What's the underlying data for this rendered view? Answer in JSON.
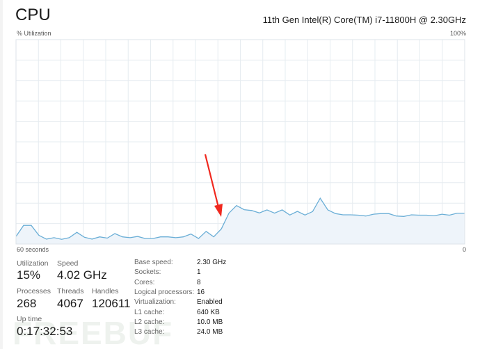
{
  "header": {
    "title": "CPU",
    "model": "11th Gen Intel(R) Core(TM) i7-11800H @ 2.30GHz"
  },
  "graph": {
    "y_label": "% Utilization",
    "y_max_label": "100%",
    "x_left_label": "60 seconds",
    "x_right_label": "0",
    "line_color": "#6aaed6",
    "fill_color": "#eef4fa",
    "grid_color": "#e6ecf0",
    "values": [
      3.7,
      9.1,
      9.1,
      4.3,
      2.4,
      3.1,
      2.3,
      3.1,
      5.7,
      3.3,
      2.4,
      3.5,
      2.9,
      5.1,
      3.5,
      3.1,
      3.7,
      2.7,
      2.7,
      3.5,
      3.5,
      3.1,
      3.5,
      4.9,
      2.7,
      6.2,
      3.5,
      7.4,
      15.1,
      18.8,
      16.8,
      16.4,
      15.2,
      16.7,
      15.1,
      16.7,
      14.2,
      16.0,
      14.2,
      15.9,
      22.4,
      16.7,
      14.9,
      14.3,
      14.3,
      14.1,
      13.7,
      14.6,
      14.9,
      14.9,
      13.7,
      13.5,
      14.3,
      14.1,
      14.1,
      13.8,
      14.6,
      14.1,
      15.1,
      15.1
    ]
  },
  "annotation": {
    "arrow_color": "#f0281e"
  },
  "stats": {
    "utilization": {
      "label": "Utilization",
      "value": "15%"
    },
    "speed": {
      "label": "Speed",
      "value": "4.02 GHz"
    },
    "processes": {
      "label": "Processes",
      "value": "268"
    },
    "threads": {
      "label": "Threads",
      "value": "4067"
    },
    "handles": {
      "label": "Handles",
      "value": "120611"
    },
    "uptime": {
      "label": "Up time",
      "value": "0:17:32:53"
    }
  },
  "specs": [
    {
      "key": "Base speed:",
      "value": "2.30 GHz"
    },
    {
      "key": "Sockets:",
      "value": "1"
    },
    {
      "key": "Cores:",
      "value": "8"
    },
    {
      "key": "Logical processors:",
      "value": "16"
    },
    {
      "key": "Virtualization:",
      "value": "Enabled"
    },
    {
      "key": "L1 cache:",
      "value": "640 KB"
    },
    {
      "key": "L2 cache:",
      "value": "10.0 MB"
    },
    {
      "key": "L3 cache:",
      "value": "24.0 MB"
    }
  ],
  "watermark": "FREEBUF"
}
